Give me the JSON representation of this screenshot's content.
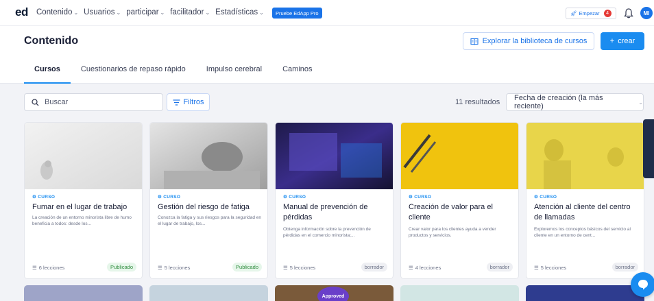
{
  "nav": {
    "logo": "ed",
    "links": [
      "Contenido",
      "Usuarios",
      "participar",
      "facilitador",
      "Estadísticas"
    ],
    "pro_label": "Pruebe EdApp Pro",
    "start_label": "Empezar",
    "start_badge": "4",
    "avatar_initials": "MI"
  },
  "header": {
    "title": "Contenido",
    "explore_label": "Explorar la biblioteca de cursos",
    "create_label": "crear",
    "tabs": [
      "Cursos",
      "Cuestionarios de repaso rápido",
      "Impulso cerebral",
      "Caminos"
    ],
    "active_tab": "Cursos"
  },
  "toolbar": {
    "search_placeholder": "Buscar",
    "filters_label": "Filtros",
    "results": "11 resultados",
    "sort_label": "Fecha de creación (la más reciente)"
  },
  "cards": [
    {
      "kind": "CURSO",
      "title": "Fumar en el lugar de trabajo",
      "desc": "La creación de un entorno minorista libre de humo beneficia a todos: desde los...",
      "lessons": "6 lecciones",
      "status": "Publicado"
    },
    {
      "kind": "CURSO",
      "title": "Gestión del riesgo de fatiga",
      "desc": "Conozca la fatiga y sus riesgos para la seguridad en el lugar de trabajo, los...",
      "lessons": "5 lecciones",
      "status": "Publicado"
    },
    {
      "kind": "CURSO",
      "title": "Manual de prevención de pérdidas",
      "desc": "Obtenga información sobre la prevención de pérdidas en el comercio minorista;...",
      "lessons": "5 lecciones",
      "status": "borrador"
    },
    {
      "kind": "CURSO",
      "title": "Creación de valor para el cliente",
      "desc": "Crear valor para los clientes ayuda a vender productos y servicios.",
      "lessons": "4 lecciones",
      "status": "borrador"
    },
    {
      "kind": "CURSO",
      "title": "Atención al cliente del centro de llamadas",
      "desc": "Exploremos los conceptos básicos del servicio al cliente en un entorno de cent...",
      "lessons": "5 lecciones",
      "status": "borrador"
    }
  ],
  "row2_badge": "Approved",
  "colors": {
    "accent": "#1a8cf0",
    "published": "#2e8b3d",
    "draft": "#6c7287"
  }
}
